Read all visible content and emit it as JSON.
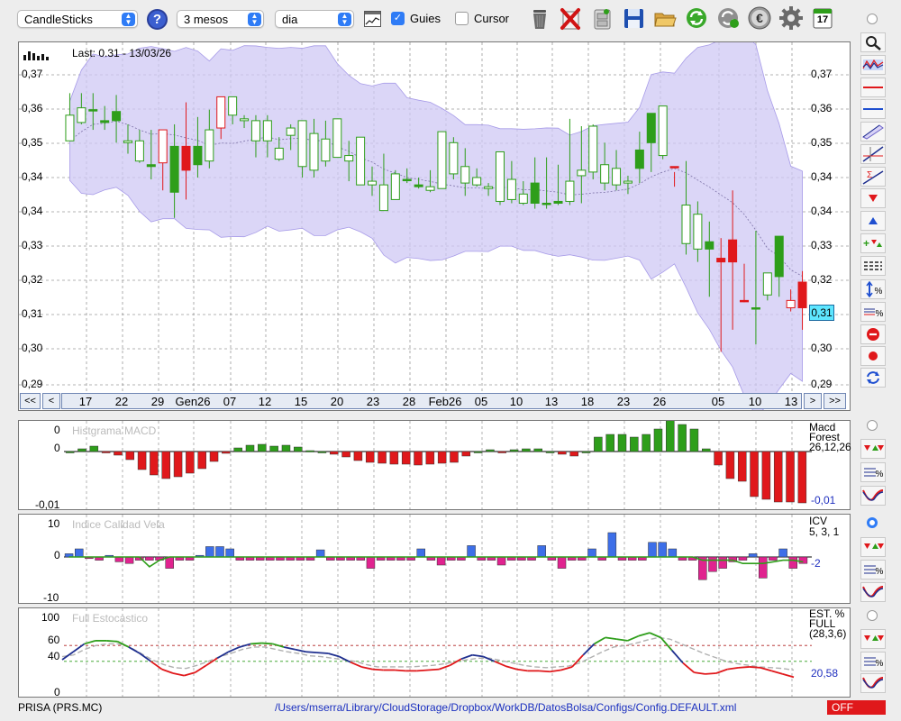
{
  "toolbar": {
    "chart_type": "CandleSticks",
    "period": "3 mesos",
    "interval": "dia",
    "guides_label": "Guies",
    "guides_checked": true,
    "cursor_label": "Cursor",
    "cursor_checked": false,
    "help_icon": "?",
    "calendar_day": "17"
  },
  "main_chart": {
    "last_label": "Last: 0.31 - 13/03/26",
    "y_ticks": [
      "0,37",
      "0,36",
      "0,35",
      "0,34",
      "0,34",
      "0,33",
      "0,32",
      "0,31",
      "0,30",
      "0,29"
    ],
    "x_labels": [
      "17",
      "22",
      "29",
      "Gen26",
      "07",
      "12",
      "15",
      "20",
      "23",
      "28",
      "Feb26",
      "05",
      "10",
      "13",
      "18",
      "23",
      "26",
      "05",
      "10",
      "13"
    ],
    "current_value": "0,31",
    "nav_first": "<<",
    "nav_prev": "<",
    "nav_next": ">",
    "nav_last": ">>",
    "up_color": "#2e9e1a",
    "down_color": "#e0181b",
    "band_color": "#cfc8f4"
  },
  "chart_data": {
    "type": "candlestick",
    "period_label": "3 mesos",
    "candles": [
      [
        0.3625,
        0.3685,
        0.3555,
        0.3555,
        "up"
      ],
      [
        0.3645,
        0.3685,
        0.36,
        0.3605,
        "up"
      ],
      [
        0.364,
        0.3685,
        0.3585,
        0.364,
        "up"
      ],
      [
        0.3605,
        0.365,
        0.3585,
        0.361,
        "up"
      ],
      [
        0.361,
        0.368,
        0.355,
        0.3635,
        "up"
      ],
      [
        0.3555,
        0.36,
        0.352,
        0.355,
        "up"
      ],
      [
        0.3555,
        0.3585,
        0.3495,
        0.35,
        "up"
      ],
      [
        0.3485,
        0.3585,
        0.345,
        0.349,
        "up"
      ],
      [
        0.3495,
        0.3585,
        0.342,
        0.3585,
        "down"
      ],
      [
        0.3415,
        0.36,
        0.3345,
        0.354,
        "up"
      ],
      [
        0.354,
        0.366,
        0.3395,
        0.3475,
        "down"
      ],
      [
        0.349,
        0.362,
        0.3455,
        0.354,
        "up"
      ],
      [
        0.3585,
        0.364,
        0.348,
        0.35,
        "up"
      ],
      [
        0.359,
        0.366,
        0.356,
        0.3675,
        "down"
      ],
      [
        0.3675,
        0.3675,
        0.36,
        0.3625,
        "up"
      ],
      [
        0.3615,
        0.3625,
        0.359,
        0.361,
        "up"
      ],
      [
        0.361,
        0.3625,
        0.351,
        0.3555,
        "up"
      ],
      [
        0.361,
        0.3625,
        0.351,
        0.3555,
        "up"
      ],
      [
        0.3535,
        0.3565,
        0.35,
        0.3505,
        "up"
      ],
      [
        0.359,
        0.36,
        0.353,
        0.357,
        "up"
      ],
      [
        0.361,
        0.361,
        0.3455,
        0.3485,
        "up"
      ],
      [
        0.3575,
        0.3615,
        0.3455,
        0.3475,
        "up"
      ],
      [
        0.356,
        0.361,
        0.3485,
        0.35,
        "up"
      ],
      [
        0.3615,
        0.3615,
        0.351,
        0.351,
        "up"
      ],
      [
        0.3515,
        0.3555,
        0.3445,
        0.35,
        "up"
      ],
      [
        0.3565,
        0.3565,
        0.347,
        0.3435,
        "up"
      ],
      [
        0.3445,
        0.3485,
        0.3405,
        0.3435,
        "up"
      ],
      [
        0.3435,
        0.352,
        0.3365,
        0.3365,
        "up"
      ],
      [
        0.3465,
        0.3475,
        0.3395,
        0.3395,
        "up"
      ],
      [
        0.345,
        0.348,
        0.344,
        0.345,
        "up"
      ],
      [
        0.343,
        0.3455,
        0.3425,
        0.3435,
        "up"
      ],
      [
        0.343,
        0.3475,
        0.3415,
        0.342,
        "up"
      ],
      [
        0.358,
        0.358,
        0.3425,
        0.3425,
        "up"
      ],
      [
        0.355,
        0.3565,
        0.345,
        0.3465,
        "up"
      ],
      [
        0.3485,
        0.3535,
        0.3405,
        0.344,
        "up"
      ],
      [
        0.3455,
        0.348,
        0.343,
        0.3435,
        "up"
      ],
      [
        0.343,
        0.344,
        0.3405,
        0.3425,
        "up"
      ],
      [
        0.3525,
        0.3525,
        0.338,
        0.339,
        "up"
      ],
      [
        0.345,
        0.35,
        0.3385,
        0.3395,
        "up"
      ],
      [
        0.341,
        0.3445,
        0.338,
        0.3385,
        "up"
      ],
      [
        0.3385,
        0.351,
        0.337,
        0.344,
        "up"
      ],
      [
        0.3385,
        0.351,
        0.337,
        0.3385,
        "up"
      ],
      [
        0.3385,
        0.349,
        0.338,
        0.339,
        "up"
      ],
      [
        0.3445,
        0.3615,
        0.338,
        0.339,
        "up"
      ],
      [
        0.3475,
        0.3595,
        0.3385,
        0.346,
        "up"
      ],
      [
        0.3595,
        0.36,
        0.345,
        0.347,
        "up"
      ],
      [
        0.349,
        0.355,
        0.342,
        0.344,
        "up"
      ],
      [
        0.348,
        0.353,
        0.342,
        0.3435,
        "up"
      ],
      [
        0.3445,
        0.346,
        0.341,
        0.344,
        "up"
      ],
      [
        0.348,
        0.358,
        0.344,
        0.353,
        "up"
      ],
      [
        0.355,
        0.3625,
        0.347,
        0.363,
        "up"
      ],
      [
        0.365,
        0.365,
        0.3505,
        0.3515,
        "up"
      ],
      [
        0.3485,
        0.347,
        0.343,
        0.3485,
        "down"
      ],
      [
        0.338,
        0.35,
        0.3245,
        0.3275,
        "up"
      ],
      [
        0.3355,
        0.339,
        0.3225,
        0.326,
        "up"
      ],
      [
        0.326,
        0.3335,
        0.313,
        0.328,
        "up"
      ],
      [
        0.3235,
        0.329,
        0.298,
        0.3225,
        "down"
      ],
      [
        0.3285,
        0.342,
        0.304,
        0.3225,
        "down"
      ],
      [
        0.312,
        0.322,
        0.3115,
        0.312,
        "down"
      ],
      [
        0.31,
        0.331,
        0.3,
        0.31,
        "up"
      ],
      [
        0.3195,
        0.3195,
        0.312,
        0.3135,
        "up"
      ],
      [
        0.3185,
        0.3285,
        0.313,
        0.3295,
        "up"
      ],
      [
        0.31,
        0.315,
        0.309,
        0.312,
        "down"
      ],
      [
        0.317,
        0.32,
        0.304,
        0.31,
        "down"
      ]
    ],
    "macd": {
      "title": "Histgrama MACD",
      "labels": [
        "Macd",
        "Forest",
        "26,12,26"
      ],
      "y_ticks": [
        "0",
        "0",
        "-0,01"
      ],
      "value": "-0,01",
      "bars": [
        0.0,
        0.3,
        0.6,
        -0.1,
        -0.4,
        -0.9,
        -2.0,
        -2.6,
        -3.0,
        -2.8,
        -2.4,
        -1.9,
        -1.1,
        -0.2,
        0.4,
        0.7,
        0.8,
        0.6,
        0.7,
        0.5,
        0.1,
        0.0,
        -0.3,
        -0.6,
        -1.0,
        -1.2,
        -1.3,
        -1.4,
        -1.4,
        -1.5,
        -1.4,
        -1.3,
        -1.2,
        -0.5,
        0.0,
        0.2,
        -0.1,
        0.2,
        0.3,
        0.3,
        0.0,
        -0.3,
        -0.5,
        0.0,
        1.6,
        1.9,
        1.9,
        1.6,
        1.9,
        2.5,
        3.5,
        3.0,
        2.5,
        0.3,
        -1.5,
        -3.0,
        -3.3,
        -5.0,
        -5.3,
        -5.6,
        -5.6,
        -5.7
      ]
    },
    "icv": {
      "title": "Indice Calidad Vela",
      "labels": [
        "ICV",
        "5, 3, 1"
      ],
      "y_ticks": [
        "10",
        "0",
        "-10"
      ],
      "value": "-2",
      "bars": [
        1.0,
        2.5,
        -0.5,
        -1.0,
        0.5,
        -1.5,
        -2.0,
        -1.0,
        -1.0,
        -1.0,
        -3.5,
        -1.0,
        -1.0,
        0.5,
        3.2,
        3.2,
        2.5,
        -1.0,
        -1.0,
        -1.0,
        -1.0,
        -1.0,
        -1.0,
        -1.0,
        -1.0,
        2.2,
        -1.0,
        -1.0,
        -1.0,
        -1.0,
        -3.5,
        -1.0,
        -1.0,
        -1.0,
        -1.0,
        2.5,
        -1.0,
        -2.5,
        -1.0,
        -1.0,
        3.5,
        -1.0,
        -1.0,
        -2.5,
        -1.0,
        -1.0,
        -1.0,
        3.5,
        -1.0,
        -3.5,
        -1.0,
        -1.0,
        2.5,
        -1.0,
        7.5,
        -1.0,
        -1.0,
        -1.0,
        4.5,
        4.5,
        2.5,
        -1.0,
        -1.0,
        -7.0,
        -4.5,
        -3.5,
        -1.5,
        -1.0,
        1.0,
        -6.5,
        -1.0,
        2.5,
        -3.5,
        -2.0
      ],
      "signal": [
        0.0,
        0.0,
        0.0,
        0.0,
        0.0,
        0.0,
        0.0,
        0.0,
        -3.0,
        -1.0,
        0.0,
        0.0,
        0.0,
        0.0,
        0.0,
        0.0,
        0.0,
        0.0,
        0.0,
        0.0,
        0.0,
        0.0,
        0.0,
        0.0,
        0.0,
        0.0,
        0.0,
        0.0,
        0.0,
        0.0,
        0.0,
        0.0,
        0.0,
        0.0,
        0.0,
        0.0,
        0.0,
        0.0,
        0.0,
        0.0,
        0.0,
        0.0,
        0.0,
        0.0,
        0.0,
        0.0,
        0.0,
        0.0,
        0.0,
        0.0,
        0.0,
        0.0,
        0.0,
        0.0,
        0.0,
        0.0,
        0.0,
        0.0,
        0.0,
        0.0,
        0.0,
        0.0,
        0.0,
        -1.0,
        -1.0,
        -1.0,
        -1.0,
        -2.0,
        -2.0,
        -2.0,
        -1.5,
        -1.0,
        -1.0,
        -1.5
      ]
    },
    "stoch": {
      "title": "Full Estocastico",
      "labels": [
        "EST. %",
        "FULL",
        "(28,3,6)"
      ],
      "y_ticks": [
        "100",
        "60",
        "40",
        "0"
      ],
      "value": "20,58",
      "k_line": [
        42,
        52,
        62,
        66,
        66,
        65,
        58,
        50,
        40,
        30,
        25,
        22,
        26,
        35,
        44,
        52,
        58,
        62,
        63,
        62,
        58,
        55,
        52,
        51,
        50,
        46,
        39,
        33,
        30,
        29,
        29,
        28,
        28,
        29,
        30,
        35,
        43,
        48,
        46,
        40,
        34,
        30,
        28,
        28,
        27,
        29,
        33,
        48,
        62,
        70,
        68,
        66,
        72,
        76,
        70,
        54,
        38,
        26,
        24,
        25,
        30,
        32,
        33,
        32,
        28,
        24,
        20
      ],
      "d_line": [
        46,
        48,
        55,
        60,
        62,
        62,
        58,
        50,
        42,
        36,
        32,
        31,
        35,
        40,
        46,
        50,
        55,
        58,
        58,
        55,
        52,
        50,
        47,
        46,
        44,
        42,
        40,
        36,
        33,
        33,
        33,
        33,
        34,
        35,
        37,
        40,
        42,
        44,
        44,
        41,
        38,
        35,
        33,
        32,
        33,
        34,
        38,
        45,
        52,
        58,
        60,
        63,
        67,
        70,
        68,
        62,
        56,
        50,
        45,
        40,
        37,
        35,
        33,
        32,
        31,
        29
      ],
      "k_segments_color": [
        "#e0181b",
        "#1f2f8f",
        "#2e9e1a"
      ],
      "d_color": "#b0b0b0"
    }
  },
  "right_tools": {
    "tool_names": [
      "zoom-icon",
      "candles-overlay-icon",
      "horizontal-red-line-icon",
      "horizontal-blue-line-icon",
      "trend-channel-icon",
      "trend-lines-icon",
      "sigma-lines-icon",
      "sell-arrow-icon",
      "buy-arrow-icon",
      "buy-sell-arrows-icon",
      "grid-lines-icon",
      "percent-scale-icon",
      "percent-compare-icon",
      "no-entry-icon",
      "record-icon",
      "refresh-arrows-icon"
    ]
  },
  "footer": {
    "ticker": "PRISA (PRS.MC)",
    "config_path": "/Users/mserra/Library/CloudStorage/Dropbox/WorkDB/DatosBolsa/Configs/Config.DEFAULT.xml",
    "status": "OFF"
  }
}
